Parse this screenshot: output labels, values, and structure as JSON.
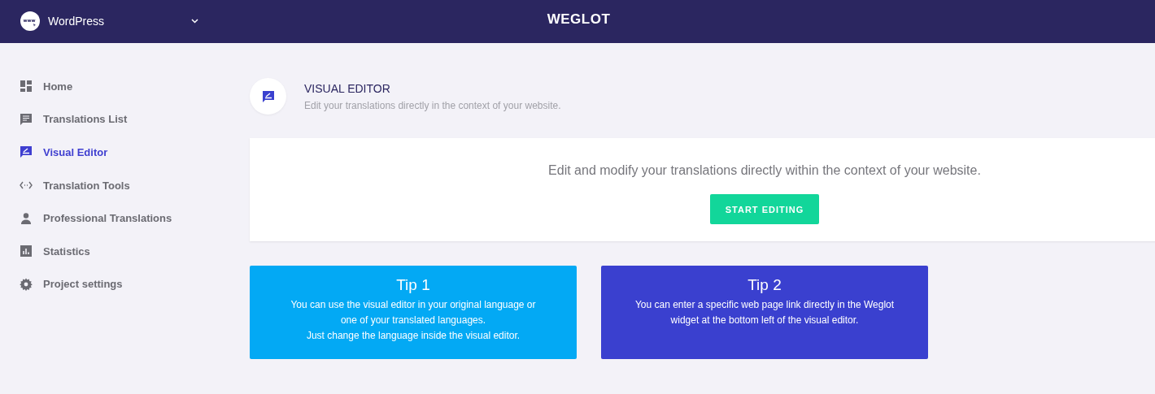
{
  "header": {
    "site": "WordPress",
    "logo": "WEGLOT"
  },
  "sidebar": {
    "items": [
      {
        "label": "Home",
        "selected": false
      },
      {
        "label": "Translations List",
        "selected": false
      },
      {
        "label": "Visual Editor",
        "selected": true
      },
      {
        "label": "Translation Tools",
        "selected": false
      },
      {
        "label": "Professional Translations",
        "selected": false
      },
      {
        "label": "Statistics",
        "selected": false
      },
      {
        "label": "Project settings",
        "selected": false
      }
    ]
  },
  "page": {
    "title": "VISUAL EDITOR",
    "subtitle": "Edit your translations directly in the context of your website."
  },
  "banner": {
    "text": "Edit and modify your translations directly within the context of your website.",
    "button": "START EDITING"
  },
  "tips": [
    {
      "title": "Tip 1",
      "color": "#03a9f4",
      "lines": [
        "You can use the visual editor in your original language or",
        "one of your translated languages.",
        "Just change the language inside the visual editor."
      ]
    },
    {
      "title": "Tip 2",
      "color": "#3a40cf",
      "lines": [
        "You can enter a specific web page link directly in the Weglot",
        "widget at the bottom left of the visual editor."
      ]
    }
  ]
}
